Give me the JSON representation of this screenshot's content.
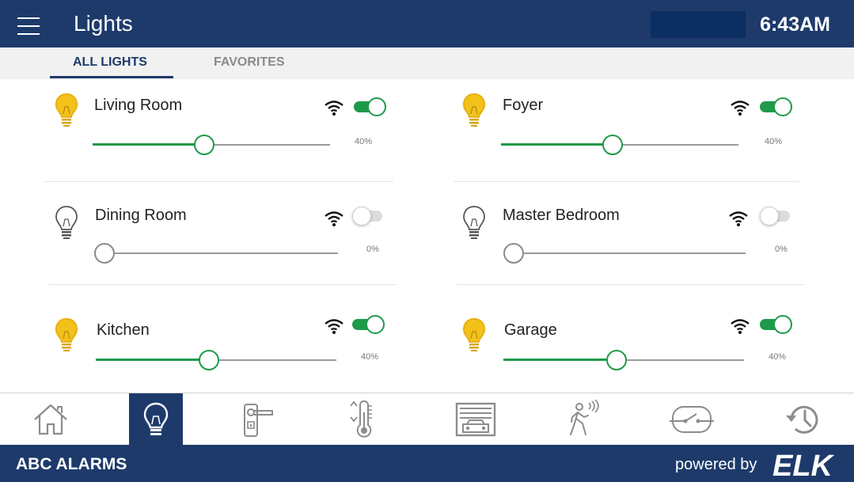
{
  "header": {
    "title": "Lights",
    "time": "6:43AM"
  },
  "tabs": [
    {
      "label": "ALL LIGHTS",
      "active": true
    },
    {
      "label": "FAVORITES",
      "active": false
    }
  ],
  "lights": [
    {
      "name": "Living Room",
      "on": true,
      "level_percent": 40,
      "level_label": "40%"
    },
    {
      "name": "Foyer",
      "on": true,
      "level_percent": 40,
      "level_label": "40%"
    },
    {
      "name": "Dining Room",
      "on": false,
      "level_percent": 0,
      "level_label": "0%"
    },
    {
      "name": "Master Bedroom",
      "on": false,
      "level_percent": 0,
      "level_label": "0%"
    },
    {
      "name": "Kitchen",
      "on": true,
      "level_percent": 40,
      "level_label": "40%"
    },
    {
      "name": "Garage",
      "on": true,
      "level_percent": 40,
      "level_label": "40%"
    }
  ],
  "bottom_nav": [
    {
      "icon": "home-icon",
      "active": false
    },
    {
      "icon": "lightbulb-icon",
      "active": true
    },
    {
      "icon": "door-lock-icon",
      "active": false
    },
    {
      "icon": "thermostat-icon",
      "active": false
    },
    {
      "icon": "garage-icon",
      "active": false
    },
    {
      "icon": "motion-sensor-icon",
      "active": false
    },
    {
      "icon": "switch-icon",
      "active": false
    },
    {
      "icon": "history-icon",
      "active": false
    }
  ],
  "footer": {
    "brand": "ABC ALARMS",
    "powered_by": "powered by",
    "logo_text": "ELK"
  },
  "colors": {
    "primary": "#1d3a6b",
    "accent_green": "#1f9a4a",
    "bulb_on": "#f2c21b",
    "bulb_off": "#555555"
  }
}
